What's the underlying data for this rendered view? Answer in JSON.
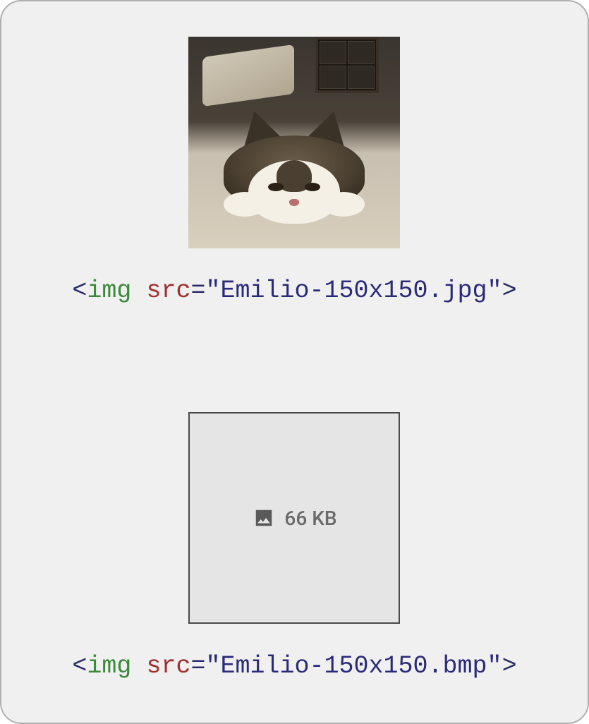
{
  "examples": [
    {
      "code": {
        "open_bracket": "<",
        "tag": "img",
        "attr": "src",
        "equals": "=",
        "string": "\"Emilio-150x150.jpg\"",
        "close_bracket": ">"
      }
    },
    {
      "placeholder": {
        "size_label": "66 KB"
      },
      "code": {
        "open_bracket": "<",
        "tag": "img",
        "attr": "src",
        "equals": "=",
        "string": "\"Emilio-150x150.bmp\"",
        "close_bracket": ">"
      }
    }
  ]
}
